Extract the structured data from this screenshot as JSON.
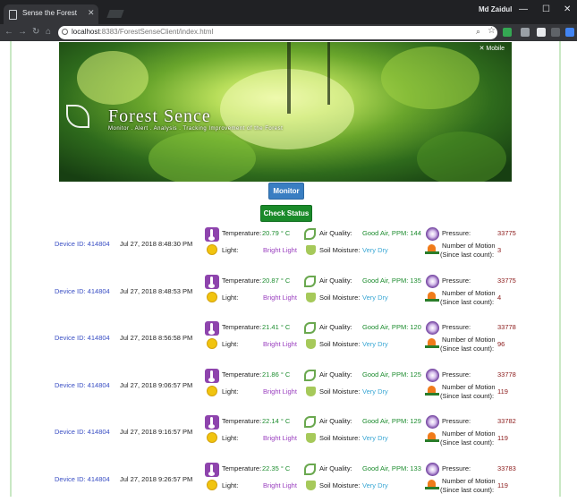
{
  "browser": {
    "tab_title": "Sense the Forest",
    "tab_close": "✕",
    "user_name": "Md Zaidul",
    "url_host": "localhost",
    "url_rest": ":8383/ForestSenseClient/index.html",
    "nav_back": "←",
    "nav_forward": "→",
    "nav_reload": "↻",
    "nav_home": "⌂",
    "win_minimize": "—",
    "win_maximize": "☐",
    "win_close": "✕",
    "search_glyph": "⌕",
    "star_glyph": "☆",
    "extension_colors": [
      "#34a853",
      "#9aa0a6",
      "#e8eaed",
      "#5f6368",
      "#4285f4"
    ]
  },
  "banner": {
    "logo_title": "Forest Sence",
    "logo_subtitle": "Monitor . Alert . Analysis . Tracking Improvement of the Forest",
    "corner_text": "✕ Mobile"
  },
  "buttons": {
    "monitor": "Monitor",
    "check_status": "Check Status"
  },
  "labels": {
    "temperature": "Temperature:",
    "air_quality": "Air Quality:",
    "pressure": "Pressure:",
    "light": "Light:",
    "soil_moisture": "Soil Moisture:",
    "motion_line1": "Number of Motion",
    "motion_line2": "(Since last count):"
  },
  "rows": [
    {
      "device": "Device ID: 414804",
      "time": "Jul 27, 2018 8:48:30 PM",
      "temperature": "20.79 ° C",
      "air": "Good Air, PPM: 144",
      "pressure": "33775",
      "light": "Bright Light",
      "soil": "Very Dry",
      "motion": "3"
    },
    {
      "device": "Device ID: 414804",
      "time": "Jul 27, 2018 8:48:53 PM",
      "temperature": "20.87 ° C",
      "air": "Good Air, PPM: 135",
      "pressure": "33775",
      "light": "Bright Light",
      "soil": "Very Dry",
      "motion": "4"
    },
    {
      "device": "Device ID: 414804",
      "time": "Jul 27, 2018 8:56:58 PM",
      "temperature": "21.41 ° C",
      "air": "Good Air, PPM: 120",
      "pressure": "33778",
      "light": "Bright Light",
      "soil": "Very Dry",
      "motion": "96"
    },
    {
      "device": "Device ID: 414804",
      "time": "Jul 27, 2018 9:06:57 PM",
      "temperature": "21.86 ° C",
      "air": "Good Air, PPM: 125",
      "pressure": "33778",
      "light": "Bright Light",
      "soil": "Very Dry",
      "motion": "119"
    },
    {
      "device": "Device ID: 414804",
      "time": "Jul 27, 2018 9:16:57 PM",
      "temperature": "22.14 ° C",
      "air": "Good Air, PPM: 129",
      "pressure": "33782",
      "light": "Bright Light",
      "soil": "Very Dry",
      "motion": "119"
    },
    {
      "device": "Device ID: 414804",
      "time": "Jul 27, 2018 9:26:57 PM",
      "temperature": "22.35 ° C",
      "air": "Good Air, PPM: 133",
      "pressure": "33783",
      "light": "Bright Light",
      "soil": "Very Dry",
      "motion": "119"
    }
  ]
}
